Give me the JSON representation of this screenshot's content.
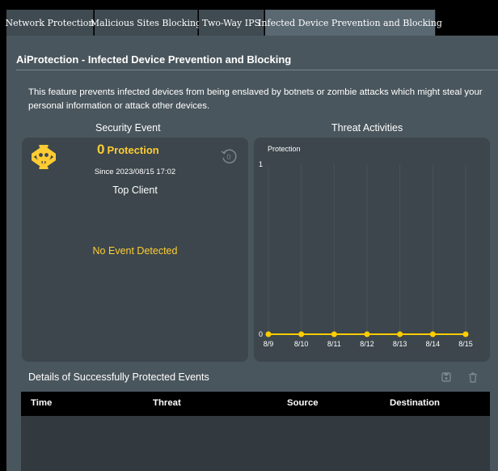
{
  "tabs": [
    {
      "label": "Network Protection"
    },
    {
      "label": "Malicious Sites Blocking"
    },
    {
      "label": "Two-Way IPS"
    },
    {
      "label": "Infected Device Prevention and Blocking",
      "active": true
    }
  ],
  "page": {
    "title": "AiProtection - Infected Device Prevention and Blocking",
    "description": "This feature prevents infected devices from being enslaved by botnets or zombie attacks which might steal your personal information or attack other devices."
  },
  "security_event": {
    "title": "Security Event",
    "count": "0",
    "count_label": "Protection",
    "since": "Since 2023/08/15 17:02",
    "top_client_label": "Top Client",
    "no_event": "No Event Detected"
  },
  "threat_activities": {
    "title": "Threat Activities",
    "legend": "Protection"
  },
  "chart_data": {
    "type": "line",
    "title": "Threat Activities",
    "series": [
      {
        "name": "Protection",
        "values": [
          0,
          0,
          0,
          0,
          0,
          0,
          0
        ],
        "color": "#ffcc00"
      }
    ],
    "categories": [
      "8/9",
      "8/10",
      "8/11",
      "8/12",
      "8/13",
      "8/14",
      "8/15"
    ],
    "ylim": [
      0,
      1
    ],
    "yticks": [
      "0",
      "1"
    ],
    "grid": true
  },
  "details": {
    "title": "Details of Successfully Protected Events",
    "columns": [
      "Time",
      "Threat",
      "Source",
      "Destination"
    ]
  },
  "colors": {
    "accent": "#ffcc33",
    "panel": "#4a565d",
    "card": "#3c464c"
  }
}
